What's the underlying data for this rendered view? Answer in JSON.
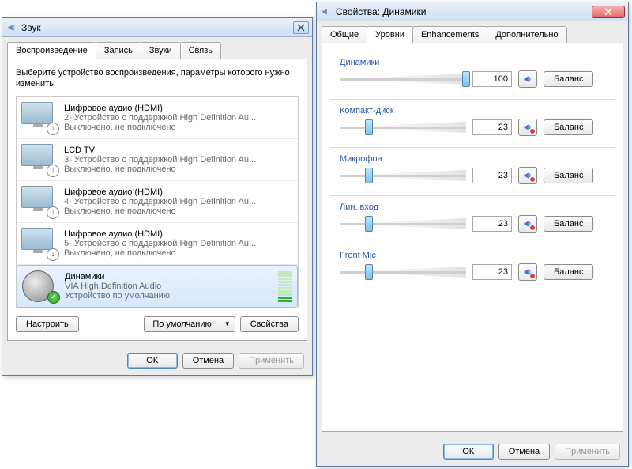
{
  "sound_window": {
    "title": "Звук",
    "tabs": [
      "Воспроизведение",
      "Запись",
      "Звуки",
      "Связь"
    ],
    "active_tab": 0,
    "instruction": "Выберите устройство воспроизведения, параметры которого нужно изменить:",
    "devices": [
      {
        "title": "Цифровое аудио (HDMI)",
        "sub": "2- Устройство с поддержкой High Definition Au...",
        "status": "Выключено, не подключено",
        "icon": "monitor",
        "badge": "down",
        "selected": false
      },
      {
        "title": "LCD TV",
        "sub": "3- Устройство с поддержкой High Definition Au...",
        "status": "Выключено, не подключено",
        "icon": "monitor",
        "badge": "down",
        "selected": false
      },
      {
        "title": "Цифровое аудио (HDMI)",
        "sub": "4- Устройство с поддержкой High Definition Au...",
        "status": "Выключено, не подключено",
        "icon": "monitor",
        "badge": "down",
        "selected": false
      },
      {
        "title": "Цифровое аудио (HDMI)",
        "sub": "5- Устройство с поддержкой High Definition Au...",
        "status": "Выключено, не подключено",
        "icon": "monitor",
        "badge": "down",
        "selected": false
      },
      {
        "title": "Динамики",
        "sub": "VIA High Definition Audio",
        "status": "Устройство по умолчанию",
        "icon": "speaker",
        "badge": "check",
        "selected": true
      }
    ],
    "buttons": {
      "configure": "Настроить",
      "set_default": "По умолчанию",
      "properties": "Свойства"
    },
    "footer": {
      "ok": "ОК",
      "cancel": "Отмена",
      "apply": "Применить"
    }
  },
  "props_window": {
    "title": "Свойства: Динамики",
    "tabs": [
      "Общие",
      "Уровни",
      "Enhancements",
      "Дополнительно"
    ],
    "active_tab": 1,
    "balance_label": "Баланс",
    "levels": [
      {
        "name": "Динамики",
        "value": 100,
        "muted": false
      },
      {
        "name": "Компакт-диск",
        "value": 23,
        "muted": true
      },
      {
        "name": "Микрофон",
        "value": 23,
        "muted": true
      },
      {
        "name": "Лин. вход",
        "value": 23,
        "muted": true
      },
      {
        "name": "Front Mic",
        "value": 23,
        "muted": true
      }
    ],
    "footer": {
      "ok": "ОК",
      "cancel": "Отмена",
      "apply": "Применить"
    }
  }
}
